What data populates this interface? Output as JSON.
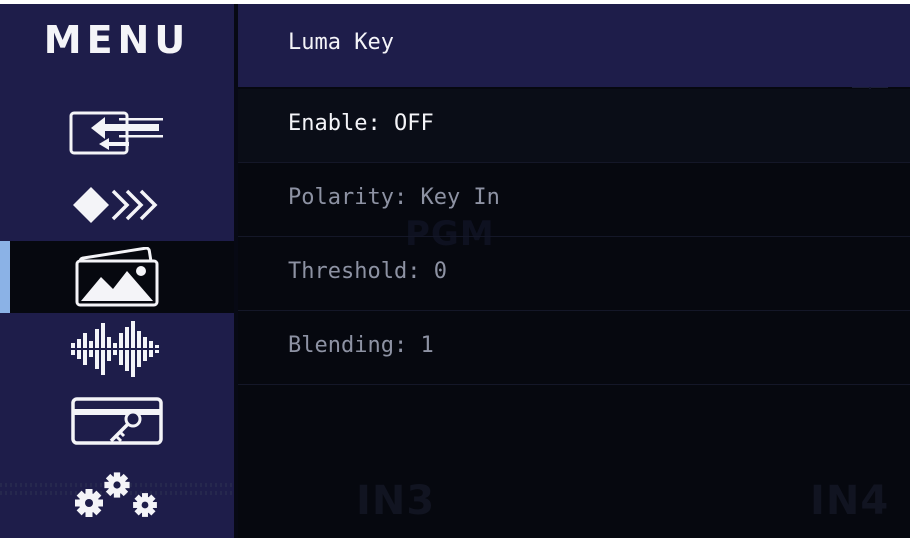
{
  "sidebar": {
    "title": "MENU",
    "items": [
      {
        "icon": "input-switch-icon",
        "selected": false
      },
      {
        "icon": "transition-icon",
        "selected": false
      },
      {
        "icon": "image-key-icon",
        "selected": true
      },
      {
        "icon": "audio-waveform-icon",
        "selected": false
      },
      {
        "icon": "key-card-icon",
        "selected": false
      },
      {
        "icon": "gears-icon",
        "selected": false
      }
    ]
  },
  "background": {
    "pgm_label": "PGM",
    "in3_label": "IN3",
    "in4_label": "IN4"
  },
  "panel": {
    "title": "Luma Key",
    "options": [
      {
        "label": "Enable: OFF",
        "highlighted": true
      },
      {
        "label": "Polarity: Key In",
        "highlighted": false
      },
      {
        "label": "Threshold: 0",
        "highlighted": false
      },
      {
        "label": "Blending: 1",
        "highlighted": false
      }
    ]
  },
  "colors": {
    "sidebar_bg": "#1e1d4a",
    "screen_bg": "#06080f",
    "selection_accent": "#8bb2e6",
    "text_active": "#f4f4f8",
    "text_inactive": "#8d92a3"
  }
}
